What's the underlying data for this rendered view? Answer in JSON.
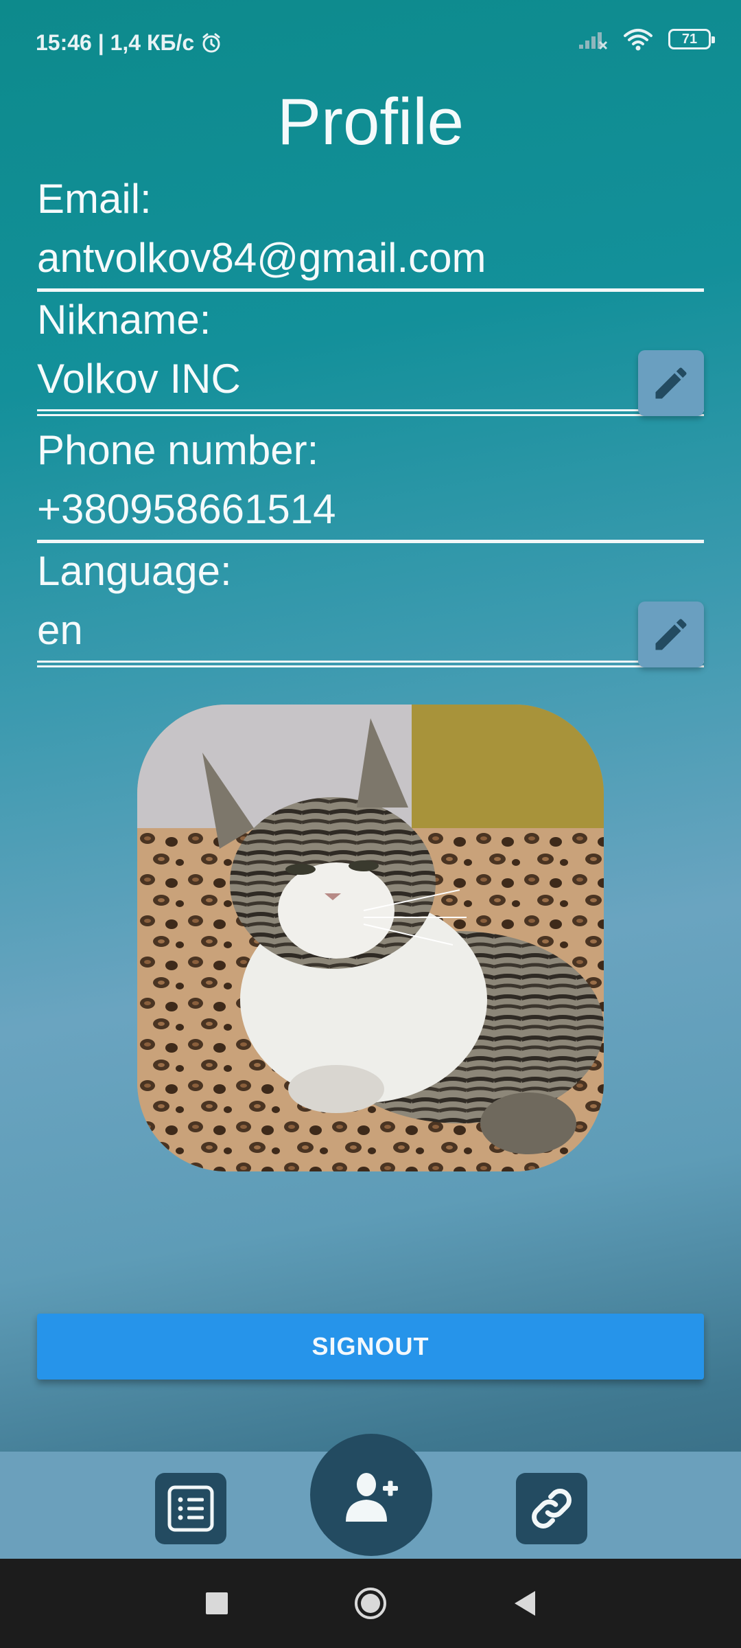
{
  "status_bar": {
    "time_speed": "15:46 | 1,4 КБ/с",
    "battery": "71",
    "icons": [
      "alarm-icon",
      "signal-icon",
      "wifi-icon",
      "battery-icon"
    ]
  },
  "page": {
    "title": "Profile"
  },
  "fields": {
    "email": {
      "label": "Email:",
      "value": "antvolkov84@gmail.com"
    },
    "nickname": {
      "label": "Nikname:",
      "value": "Volkov INC",
      "editable": true
    },
    "phone": {
      "label": "Phone number:",
      "value": "+380958661514"
    },
    "language": {
      "label": "Language:",
      "value": "en",
      "editable": true
    }
  },
  "actions": {
    "signout_label": "SIGNOUT"
  },
  "bottom_nav": {
    "items": [
      "list-icon",
      "add-user-icon",
      "link-icon"
    ]
  },
  "system_nav": {
    "items": [
      "recents-button",
      "home-button",
      "back-button"
    ]
  },
  "colors": {
    "accent": "#2694ea",
    "nav_button": "#234b61",
    "nav_bar": "#6ba0bc"
  }
}
